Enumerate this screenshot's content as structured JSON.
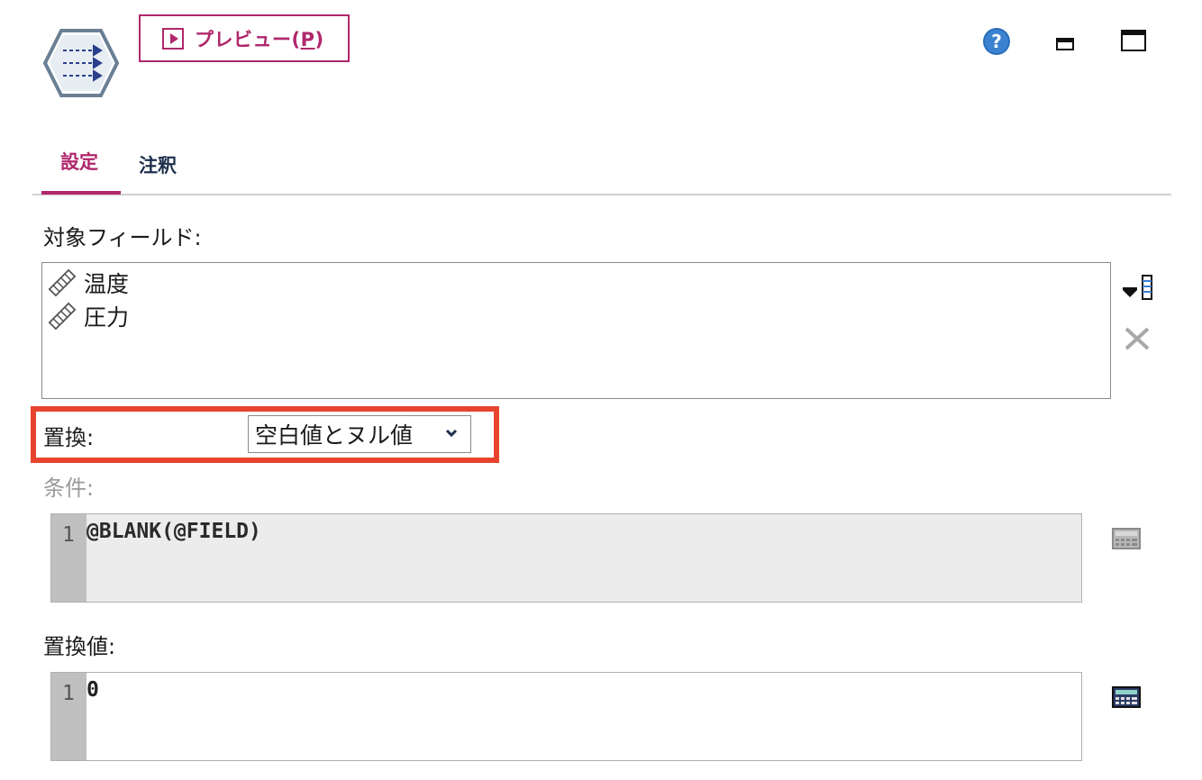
{
  "toolbar": {
    "preview_label_prefix": "プレビュー(",
    "preview_label_key": "P",
    "preview_label_suffix": ")"
  },
  "tabs": [
    {
      "label": "設定",
      "active": true
    },
    {
      "label": "注釈",
      "active": false
    }
  ],
  "fields_section": {
    "label": "対象フィールド:",
    "items": [
      {
        "name": "温度",
        "icon": "continuous-ruler-icon"
      },
      {
        "name": "圧力",
        "icon": "continuous-ruler-icon"
      }
    ]
  },
  "replace": {
    "label": "置換:",
    "selected": "空白値とヌル値"
  },
  "condition": {
    "label": "条件:",
    "line_number": "1",
    "code": "@BLANK(@FIELD)"
  },
  "replace_value": {
    "label": "置換値:",
    "line_number": "1",
    "code": "0"
  },
  "colors": {
    "accent": "#b0276b",
    "highlight": "#e8432f",
    "tab_inactive": "#1d2f4d",
    "help": "#2a6ebb"
  }
}
